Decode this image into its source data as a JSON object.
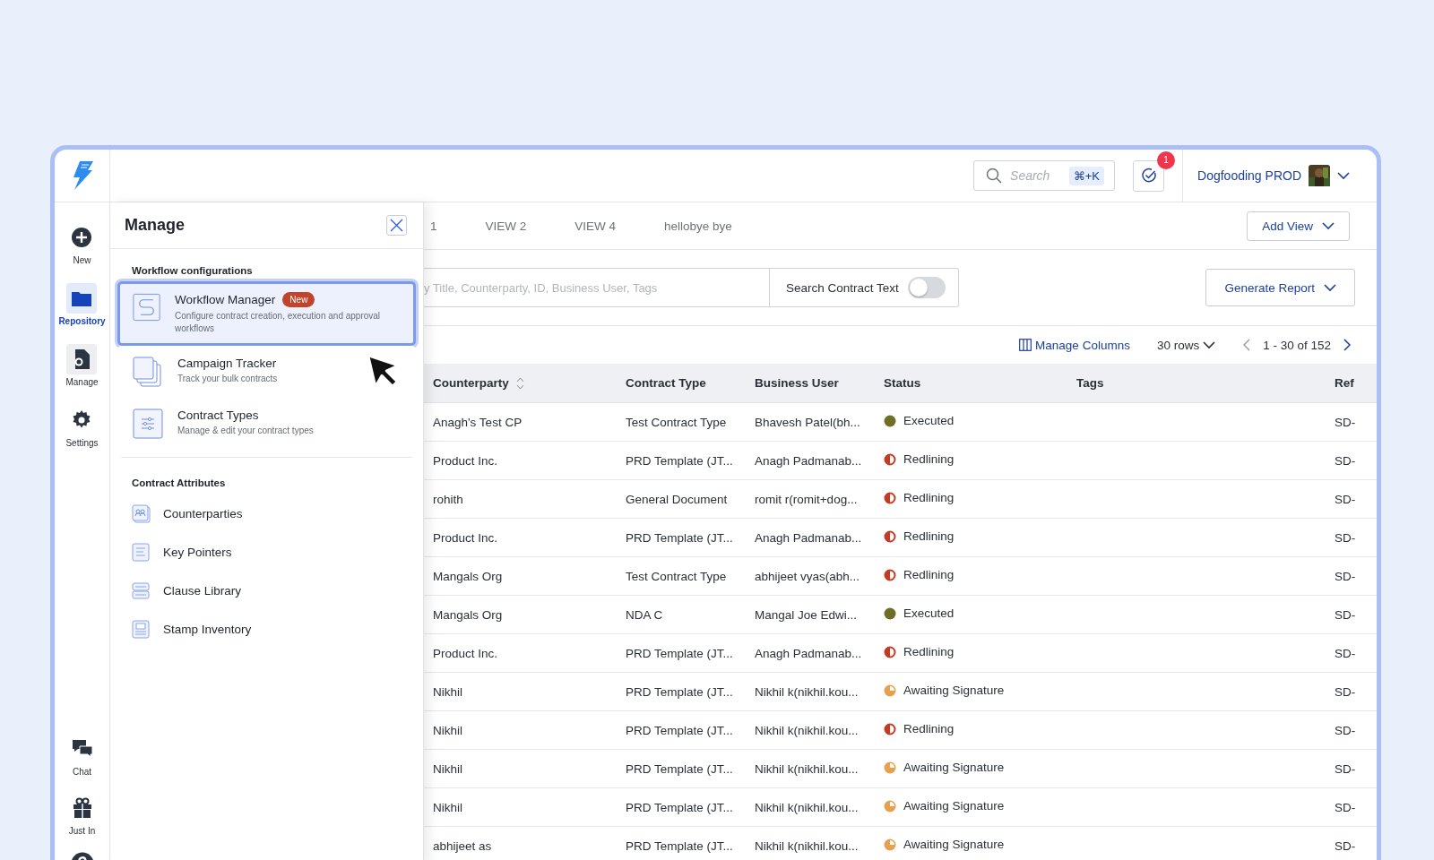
{
  "rail": {
    "items": [
      {
        "label": "New",
        "selected": false,
        "active": false
      },
      {
        "label": "Repository",
        "selected": true,
        "active": false
      },
      {
        "label": "Manage",
        "selected": false,
        "active": true
      },
      {
        "label": "Settings",
        "selected": false,
        "active": false
      }
    ],
    "bottom_items": [
      {
        "label": "Chat"
      },
      {
        "label": "Just In"
      }
    ]
  },
  "topbar": {
    "search": {
      "placeholder": "Search",
      "shortcut": "⌘+K"
    },
    "notifications": {
      "count": "1"
    },
    "workspace": "Dogfooding PROD"
  },
  "manage_panel": {
    "title": "Manage",
    "sections": [
      {
        "heading": "Workflow configurations",
        "items": [
          {
            "title": "Workflow Manager",
            "badge": "New",
            "description": "Configure contract creation, execution and approval workflows",
            "selected": true
          },
          {
            "title": "Campaign Tracker",
            "description": "Track your bulk contracts",
            "selected": false
          },
          {
            "title": "Contract Types",
            "description": "Manage & edit your contract types",
            "selected": false
          }
        ]
      },
      {
        "heading": "Contract Attributes",
        "items": [
          {
            "title": "Counterparties"
          },
          {
            "title": "Key Pointers"
          },
          {
            "title": "Clause Library"
          },
          {
            "title": "Stamp Inventory"
          }
        ]
      }
    ]
  },
  "tabs": [
    {
      "label": "1"
    },
    {
      "label": "VIEW 2"
    },
    {
      "label": "VIEW 4"
    },
    {
      "label": "hellobye bye"
    }
  ],
  "add_view": "Add View",
  "filter": {
    "placeholder": "y Title, Counterparty, ID, Business User, Tags",
    "contract_text_label": "Search Contract Text",
    "contract_text_on": false,
    "report_button": "Generate Report"
  },
  "pagination": {
    "manage_columns": "Manage Columns",
    "rows": "30 rows",
    "range": "1 - 30 of 152"
  },
  "table": {
    "columns": [
      "Counterparty",
      "Contract Type",
      "Business User",
      "Status",
      "Tags",
      "Ref"
    ],
    "rows": [
      {
        "counterparty": "Anagh's Test CP",
        "contract_type": "Test Contract Type",
        "business_user": "Bhavesh Patel(bh...",
        "status": {
          "label": "Executed",
          "kind": "executed",
          "color": "#6e6e25"
        },
        "ref": "SD-"
      },
      {
        "counterparty": "Product Inc.",
        "contract_type": "PRD Template (JT...",
        "business_user": "Anagh Padmanab...",
        "status": {
          "label": "Redlining",
          "kind": "redlining",
          "color": "#c23b22"
        },
        "ref": "SD-"
      },
      {
        "counterparty": "rohith",
        "contract_type": "General Document",
        "business_user": "romit r(romit+dog...",
        "status": {
          "label": "Redlining",
          "kind": "redlining",
          "color": "#c23b22"
        },
        "ref": "SD-"
      },
      {
        "counterparty": "Product Inc.",
        "contract_type": "PRD Template (JT...",
        "business_user": "Anagh Padmanab...",
        "status": {
          "label": "Redlining",
          "kind": "redlining",
          "color": "#c23b22"
        },
        "ref": "SD-"
      },
      {
        "counterparty": "Mangals Org",
        "contract_type": "Test Contract Type",
        "business_user": "abhijeet vyas(abh...",
        "status": {
          "label": "Redlining",
          "kind": "redlining",
          "color": "#c23b22"
        },
        "ref": "SD-"
      },
      {
        "counterparty": "Mangals Org",
        "contract_type": "NDA C",
        "business_user": "Mangal Joe Edwi...",
        "status": {
          "label": "Executed",
          "kind": "executed",
          "color": "#6e6e25"
        },
        "ref": "SD-"
      },
      {
        "counterparty": "Product Inc.",
        "contract_type": "PRD Template (JT...",
        "business_user": "Anagh Padmanab...",
        "status": {
          "label": "Redlining",
          "kind": "redlining",
          "color": "#c23b22"
        },
        "ref": "SD-"
      },
      {
        "counterparty": "Nikhil",
        "contract_type": "PRD Template (JT...",
        "business_user": "Nikhil k(nikhil.kou...",
        "status": {
          "label": "Awaiting Signature",
          "kind": "awaiting",
          "color": "#e8a04e"
        },
        "ref": "SD-"
      },
      {
        "counterparty": "Nikhil",
        "contract_type": "PRD Template (JT...",
        "business_user": "Nikhil k(nikhil.kou...",
        "status": {
          "label": "Redlining",
          "kind": "redlining",
          "color": "#c23b22"
        },
        "ref": "SD-"
      },
      {
        "counterparty": "Nikhil",
        "contract_type": "PRD Template (JT...",
        "business_user": "Nikhil k(nikhil.kou...",
        "status": {
          "label": "Awaiting Signature",
          "kind": "awaiting",
          "color": "#e8a04e"
        },
        "ref": "SD-"
      },
      {
        "counterparty": "Nikhil",
        "contract_type": "PRD Template (JT...",
        "business_user": "Nikhil k(nikhil.kou...",
        "status": {
          "label": "Awaiting Signature",
          "kind": "awaiting",
          "color": "#e8a04e"
        },
        "ref": "SD-"
      },
      {
        "counterparty": "abhijeet as",
        "contract_type": "PRD Template (JT...",
        "business_user": "Nikhil k(nikhil.kou...",
        "status": {
          "label": "Awaiting Signature",
          "kind": "awaiting",
          "color": "#e8a04e"
        },
        "ref": "SD-"
      }
    ]
  }
}
